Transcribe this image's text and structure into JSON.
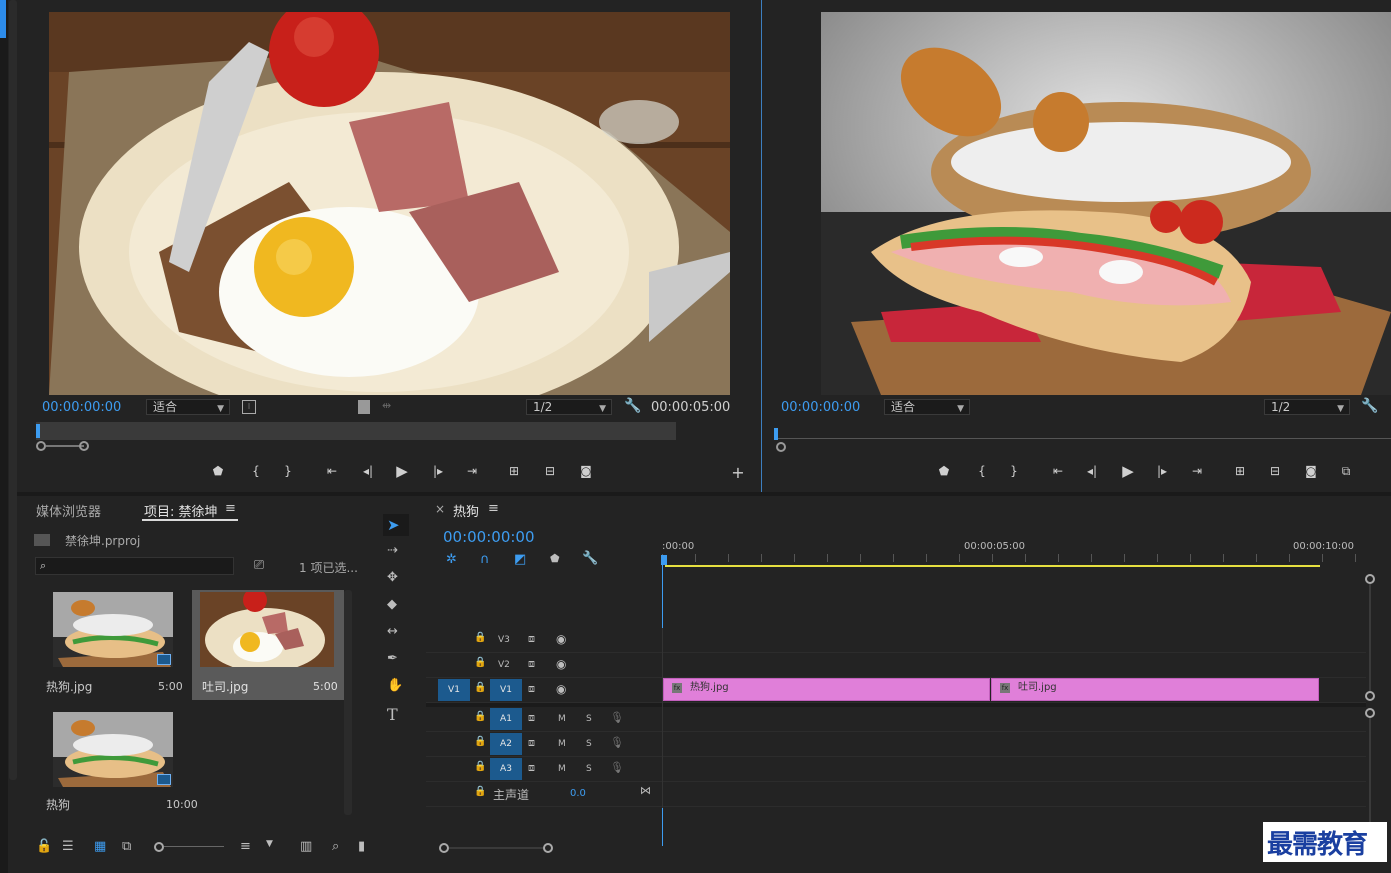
{
  "source_monitor": {
    "timecode": "00:00:00:00",
    "fit": "适合",
    "resolution": "1/2",
    "duration": "00:00:05:00"
  },
  "program_monitor": {
    "timecode": "00:00:00:00",
    "fit": "适合",
    "resolution": "1/2"
  },
  "project": {
    "tab_media": "媒体浏览器",
    "tab_project": "项目: 禁徐坤",
    "menu_glyph": "≡",
    "file": "禁徐坤.prproj",
    "selection": "1 项已选...",
    "items": [
      {
        "name": "热狗.jpg",
        "duration": "5:00"
      },
      {
        "name": "吐司.jpg",
        "duration": "5:00"
      },
      {
        "name": "热狗",
        "duration": "10:00"
      }
    ]
  },
  "timeline": {
    "close": "×",
    "sequence": "热狗",
    "menu_glyph": "≡",
    "timecode": "00:00:00:00",
    "ruler": [
      ":00:00",
      "00:00:05:00",
      "00:00:10:00"
    ],
    "tracks_video": [
      "V3",
      "V2",
      "V1"
    ],
    "tracks_audio": [
      "A1",
      "A2",
      "A3"
    ],
    "source_patch": "V1",
    "mute": "M",
    "solo": "S",
    "master_label": "主声道",
    "master_value": "0.0",
    "clips": [
      {
        "name": "热狗.jpg",
        "fx": "fx"
      },
      {
        "name": "吐司.jpg",
        "fx": "fx"
      }
    ]
  },
  "watermark": "最需教育",
  "colors": {
    "accent": "#3d9cf0",
    "clip": "#e07fd9",
    "work_area": "#e6e040",
    "patch": "#1c5a8e"
  }
}
